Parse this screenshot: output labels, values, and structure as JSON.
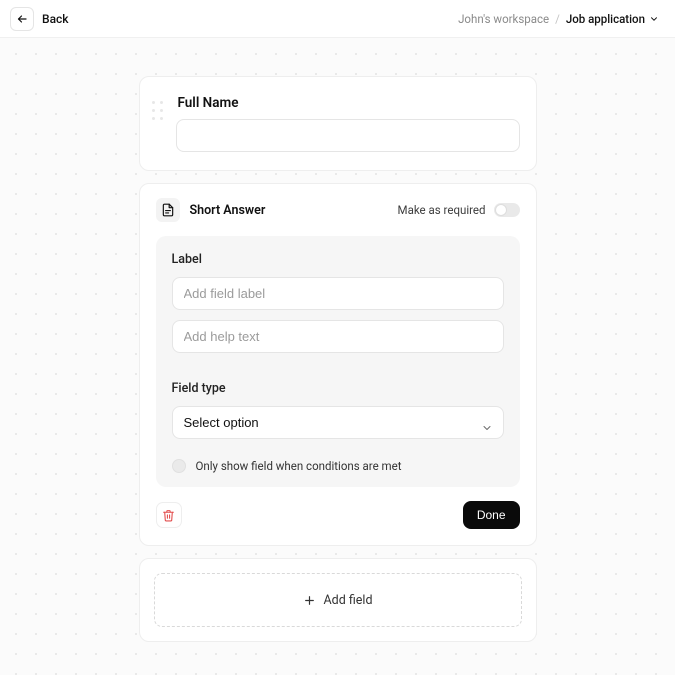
{
  "topbar": {
    "back_label": "Back",
    "workspace": "John's workspace",
    "separator": "/",
    "current": "Job application"
  },
  "name_field": {
    "title": "Full Name",
    "value": ""
  },
  "editor": {
    "type_title": "Short Answer",
    "required_label": "Make as required",
    "label_heading": "Label",
    "label_placeholder": "Add field label",
    "help_placeholder": "Add help text",
    "fieldtype_heading": "Field type",
    "fieldtype_value": "Select option",
    "condition_text": "Only show field when conditions are met",
    "done_label": "Done"
  },
  "add_field_label": "Add field"
}
